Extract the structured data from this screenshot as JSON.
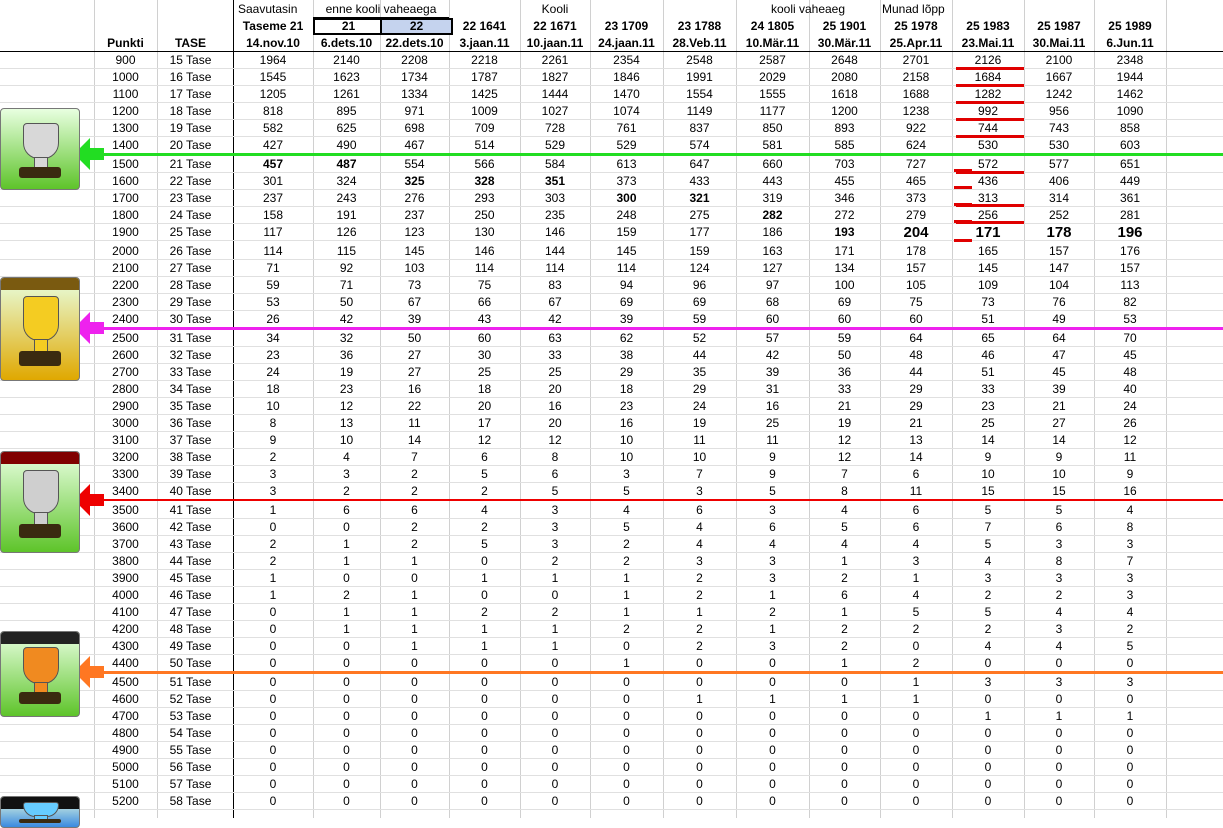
{
  "headers": {
    "row1_left": "Saavutasin",
    "row1_groups": [
      {
        "label": "enne kooli vaheaega"
      },
      {
        "label": "Kooli"
      },
      {
        "label": "kooli vaheaeg"
      },
      {
        "label": "Munad lõpp"
      }
    ],
    "row2": [
      "Taseme 21",
      "21",
      "22",
      "22  1641",
      "22  1671",
      "23  1709",
      "23  1788",
      "24  1805",
      "25  1901",
      "25  1978",
      "25  1983",
      "25  1987",
      "25  1989"
    ],
    "row3_left": [
      "Punkti",
      "TASE"
    ],
    "dates": [
      "14.nov.10",
      "6.dets.10",
      "22.dets.10",
      "3.jaan.11",
      "10.jaan.11",
      "24.jaan.11",
      "28.Veb.11",
      "10.Mär.11",
      "30.Mär.11",
      "25.Apr.11",
      "23.Mai.11",
      "30.Mai.11",
      "6.Jun.11"
    ]
  },
  "rows": [
    {
      "p": "900",
      "t": "15 Tase",
      "v": [
        "1964",
        "2140",
        "2208",
        "2218",
        "2261",
        "2354",
        "2548",
        "2587",
        "2648",
        "2701",
        "2126",
        "2100",
        "2348"
      ]
    },
    {
      "p": "1000",
      "t": "16 Tase",
      "v": [
        "1545",
        "1623",
        "1734",
        "1787",
        "1827",
        "1846",
        "1991",
        "2029",
        "2080",
        "2158",
        "1684",
        "1667",
        "1944"
      ]
    },
    {
      "p": "1100",
      "t": "17 Tase",
      "v": [
        "1205",
        "1261",
        "1334",
        "1425",
        "1444",
        "1470",
        "1554",
        "1555",
        "1618",
        "1688",
        "1282",
        "1242",
        "1462"
      ]
    },
    {
      "p": "1200",
      "t": "18 Tase",
      "v": [
        "818",
        "895",
        "971",
        "1009",
        "1027",
        "1074",
        "1149",
        "1177",
        "1200",
        "1238",
        "992",
        "956",
        "1090"
      ]
    },
    {
      "p": "1300",
      "t": "19 Tase",
      "v": [
        "582",
        "625",
        "698",
        "709",
        "728",
        "761",
        "837",
        "850",
        "893",
        "922",
        "744",
        "743",
        "858"
      ]
    },
    {
      "p": "1400",
      "t": "20 Tase",
      "v": [
        "427",
        "490",
        "467",
        "514",
        "529",
        "529",
        "574",
        "581",
        "585",
        "624",
        "530",
        "530",
        "603"
      ]
    },
    {
      "p": "1500",
      "t": "21 Tase",
      "v": [
        "457",
        "487",
        "554",
        "566",
        "584",
        "613",
        "647",
        "660",
        "703",
        "727",
        "572",
        "577",
        "651"
      ]
    },
    {
      "p": "1600",
      "t": "22 Tase",
      "v": [
        "301",
        "324",
        "325",
        "328",
        "351",
        "373",
        "433",
        "443",
        "455",
        "465",
        "436",
        "406",
        "449"
      ]
    },
    {
      "p": "1700",
      "t": "23 Tase",
      "v": [
        "237",
        "243",
        "276",
        "293",
        "303",
        "300",
        "321",
        "319",
        "346",
        "373",
        "313",
        "314",
        "361"
      ]
    },
    {
      "p": "1800",
      "t": "24 Tase",
      "v": [
        "158",
        "191",
        "237",
        "250",
        "235",
        "248",
        "275",
        "282",
        "272",
        "279",
        "256",
        "252",
        "281"
      ]
    },
    {
      "p": "1900",
      "t": "25 Tase",
      "v": [
        "117",
        "126",
        "123",
        "130",
        "146",
        "159",
        "177",
        "186",
        "193",
        "204",
        "171",
        "178",
        "196"
      ]
    },
    {
      "p": "2000",
      "t": "26 Tase",
      "v": [
        "114",
        "115",
        "145",
        "146",
        "144",
        "145",
        "159",
        "163",
        "171",
        "178",
        "165",
        "157",
        "176"
      ]
    },
    {
      "p": "2100",
      "t": "27 Tase",
      "v": [
        "71",
        "92",
        "103",
        "114",
        "114",
        "114",
        "124",
        "127",
        "134",
        "157",
        "145",
        "147",
        "157"
      ]
    },
    {
      "p": "2200",
      "t": "28 Tase",
      "v": [
        "59",
        "71",
        "73",
        "75",
        "83",
        "94",
        "96",
        "97",
        "100",
        "105",
        "109",
        "104",
        "113"
      ]
    },
    {
      "p": "2300",
      "t": "29 Tase",
      "v": [
        "53",
        "50",
        "67",
        "66",
        "67",
        "69",
        "69",
        "68",
        "69",
        "75",
        "73",
        "76",
        "82"
      ]
    },
    {
      "p": "2400",
      "t": "30 Tase",
      "v": [
        "26",
        "42",
        "39",
        "43",
        "42",
        "39",
        "59",
        "60",
        "60",
        "60",
        "51",
        "49",
        "53"
      ]
    },
    {
      "p": "2500",
      "t": "31 Tase",
      "v": [
        "34",
        "32",
        "50",
        "60",
        "63",
        "62",
        "52",
        "57",
        "59",
        "64",
        "65",
        "64",
        "70"
      ]
    },
    {
      "p": "2600",
      "t": "32 Tase",
      "v": [
        "23",
        "36",
        "27",
        "30",
        "33",
        "38",
        "44",
        "42",
        "50",
        "48",
        "46",
        "47",
        "45"
      ]
    },
    {
      "p": "2700",
      "t": "33 Tase",
      "v": [
        "24",
        "19",
        "27",
        "25",
        "25",
        "29",
        "35",
        "39",
        "36",
        "44",
        "51",
        "45",
        "48"
      ]
    },
    {
      "p": "2800",
      "t": "34 Tase",
      "v": [
        "18",
        "23",
        "16",
        "18",
        "20",
        "18",
        "29",
        "31",
        "33",
        "29",
        "33",
        "39",
        "40"
      ]
    },
    {
      "p": "2900",
      "t": "35 Tase",
      "v": [
        "10",
        "12",
        "22",
        "20",
        "16",
        "23",
        "24",
        "16",
        "21",
        "29",
        "23",
        "21",
        "24"
      ]
    },
    {
      "p": "3000",
      "t": "36 Tase",
      "v": [
        "8",
        "13",
        "11",
        "17",
        "20",
        "16",
        "19",
        "25",
        "19",
        "21",
        "25",
        "27",
        "26"
      ]
    },
    {
      "p": "3100",
      "t": "37 Tase",
      "v": [
        "9",
        "10",
        "14",
        "12",
        "12",
        "10",
        "11",
        "11",
        "12",
        "13",
        "14",
        "14",
        "12"
      ]
    },
    {
      "p": "3200",
      "t": "38 Tase",
      "v": [
        "2",
        "4",
        "7",
        "6",
        "8",
        "10",
        "10",
        "9",
        "12",
        "14",
        "9",
        "9",
        "11"
      ]
    },
    {
      "p": "3300",
      "t": "39 Tase",
      "v": [
        "3",
        "3",
        "2",
        "5",
        "6",
        "3",
        "7",
        "9",
        "7",
        "6",
        "10",
        "10",
        "9"
      ]
    },
    {
      "p": "3400",
      "t": "40 Tase",
      "v": [
        "3",
        "2",
        "2",
        "2",
        "5",
        "5",
        "3",
        "5",
        "8",
        "11",
        "15",
        "15",
        "16"
      ]
    },
    {
      "p": "3500",
      "t": "41 Tase",
      "v": [
        "1",
        "6",
        "6",
        "4",
        "3",
        "4",
        "6",
        "3",
        "4",
        "6",
        "5",
        "5",
        "4"
      ]
    },
    {
      "p": "3600",
      "t": "42 Tase",
      "v": [
        "0",
        "0",
        "2",
        "2",
        "3",
        "5",
        "4",
        "6",
        "5",
        "6",
        "7",
        "6",
        "8"
      ]
    },
    {
      "p": "3700",
      "t": "43 Tase",
      "v": [
        "2",
        "1",
        "2",
        "5",
        "3",
        "2",
        "4",
        "4",
        "4",
        "4",
        "5",
        "3",
        "3"
      ]
    },
    {
      "p": "3800",
      "t": "44 Tase",
      "v": [
        "2",
        "1",
        "1",
        "0",
        "2",
        "2",
        "3",
        "3",
        "1",
        "3",
        "4",
        "8",
        "7"
      ]
    },
    {
      "p": "3900",
      "t": "45 Tase",
      "v": [
        "1",
        "0",
        "0",
        "1",
        "1",
        "1",
        "2",
        "3",
        "2",
        "1",
        "3",
        "3",
        "3"
      ]
    },
    {
      "p": "4000",
      "t": "46 Tase",
      "v": [
        "1",
        "2",
        "1",
        "0",
        "0",
        "1",
        "2",
        "1",
        "6",
        "4",
        "2",
        "2",
        "3"
      ]
    },
    {
      "p": "4100",
      "t": "47 Tase",
      "v": [
        "0",
        "1",
        "1",
        "2",
        "2",
        "1",
        "1",
        "2",
        "1",
        "5",
        "5",
        "4",
        "4"
      ]
    },
    {
      "p": "4200",
      "t": "48 Tase",
      "v": [
        "0",
        "1",
        "1",
        "1",
        "1",
        "2",
        "2",
        "1",
        "2",
        "2",
        "2",
        "3",
        "2"
      ]
    },
    {
      "p": "4300",
      "t": "49 Tase",
      "v": [
        "0",
        "0",
        "1",
        "1",
        "1",
        "0",
        "2",
        "3",
        "2",
        "0",
        "4",
        "4",
        "5"
      ]
    },
    {
      "p": "4400",
      "t": "50 Tase",
      "v": [
        "0",
        "0",
        "0",
        "0",
        "0",
        "1",
        "0",
        "0",
        "1",
        "2",
        "0",
        "0",
        "0"
      ]
    },
    {
      "p": "4500",
      "t": "51 Tase",
      "v": [
        "0",
        "0",
        "0",
        "0",
        "0",
        "0",
        "0",
        "0",
        "0",
        "1",
        "3",
        "3",
        "3"
      ]
    },
    {
      "p": "4600",
      "t": "52 Tase",
      "v": [
        "0",
        "0",
        "0",
        "0",
        "0",
        "0",
        "1",
        "1",
        "1",
        "1",
        "0",
        "0",
        "0"
      ]
    },
    {
      "p": "4700",
      "t": "53 Tase",
      "v": [
        "0",
        "0",
        "0",
        "0",
        "0",
        "0",
        "0",
        "0",
        "0",
        "0",
        "1",
        "1",
        "1"
      ]
    },
    {
      "p": "4800",
      "t": "54 Tase",
      "v": [
        "0",
        "0",
        "0",
        "0",
        "0",
        "0",
        "0",
        "0",
        "0",
        "0",
        "0",
        "0",
        "0"
      ]
    },
    {
      "p": "4900",
      "t": "55 Tase",
      "v": [
        "0",
        "0",
        "0",
        "0",
        "0",
        "0",
        "0",
        "0",
        "0",
        "0",
        "0",
        "0",
        "0"
      ]
    },
    {
      "p": "5000",
      "t": "56 Tase",
      "v": [
        "0",
        "0",
        "0",
        "0",
        "0",
        "0",
        "0",
        "0",
        "0",
        "0",
        "0",
        "0",
        "0"
      ]
    },
    {
      "p": "5100",
      "t": "57 Tase",
      "v": [
        "0",
        "0",
        "0",
        "0",
        "0",
        "0",
        "0",
        "0",
        "0",
        "0",
        "0",
        "0",
        "0"
      ]
    },
    {
      "p": "5200",
      "t": "58 Tase",
      "v": [
        "0",
        "0",
        "0",
        "0",
        "0",
        "0",
        "0",
        "0",
        "0",
        "0",
        "0",
        "0",
        "0"
      ]
    }
  ],
  "bold_cells": [
    [
      6,
      0
    ],
    [
      6,
      1
    ],
    [
      7,
      2
    ],
    [
      7,
      3
    ],
    [
      7,
      4
    ],
    [
      8,
      5
    ],
    [
      8,
      6
    ],
    [
      9,
      7
    ],
    [
      10,
      8
    ]
  ],
  "big_cells": [
    [
      10,
      9
    ],
    [
      10,
      10
    ],
    [
      10,
      11
    ],
    [
      10,
      12
    ]
  ],
  "colors": {
    "green_line": "#22dd22",
    "magenta_line": "#ee22ee",
    "red_line": "#ee0000",
    "orange_line": "#ff7722",
    "selection": "#c5d3ee",
    "grid": "#d0d0d0"
  },
  "icons": [
    {
      "name": "silver-trophy-icon"
    },
    {
      "name": "gold-trophy-icon"
    },
    {
      "name": "silver-angel-trophy-icon"
    },
    {
      "name": "orange-crystal-trophy-icon"
    },
    {
      "name": "blue-crystal-trophy-icon"
    }
  ]
}
